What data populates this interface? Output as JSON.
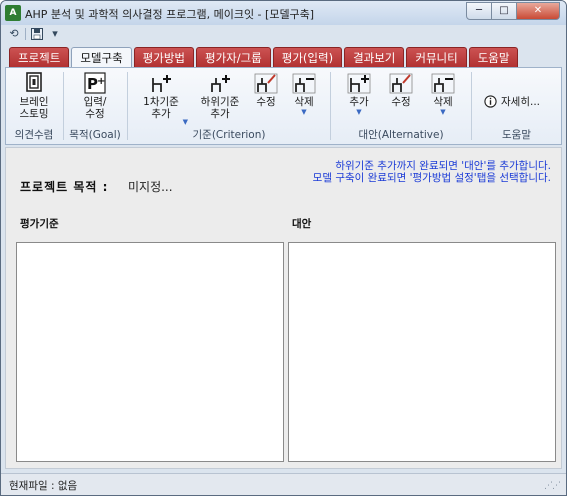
{
  "window": {
    "title": "AHP 분석 및 과학적 의사결정 프로그램, 메이크잇 - [모델구축]",
    "min_label": "─",
    "max_label": "□",
    "close_label": "✕"
  },
  "qat": {
    "undo_glyph": "⟲",
    "save_glyph": "▾"
  },
  "tabs": [
    "프로젝트",
    "모델구축",
    "평가방법",
    "평가자/그룹",
    "평가(입력)",
    "결과보기",
    "커뮤니티",
    "도움말"
  ],
  "active_tab": "모델구축",
  "ribbon": {
    "groups": {
      "brainstorm": {
        "label": "의견수렴",
        "button": "브레인\n스토밍"
      },
      "goal": {
        "label": "목적(Goal)",
        "button": "입력/\n수정"
      },
      "criterion": {
        "label": "기준(Criterion)",
        "add_first": "1차기준\n추가",
        "add_sub": "하위기준\n추가",
        "edit": "수정",
        "delete": "삭제"
      },
      "alternative": {
        "label": "대안(Alternative)",
        "add": "추가",
        "edit": "수정",
        "delete": "삭제"
      },
      "help": {
        "label": "도움말",
        "details": "자세히..."
      }
    }
  },
  "hint": {
    "line1": "하위기준 추가까지 완료되면 '대안'를 추가합니다.",
    "line2": "모델 구축이 완료되면 '평가방법 설정'탭을 선택합니다."
  },
  "goal": {
    "label": "프로젝트 목적 :",
    "value": "미지정..."
  },
  "panels": {
    "criteria": "평가기준",
    "alternatives": "대안"
  },
  "status": {
    "current_file": "현재파일 : 없음"
  },
  "colors": {
    "tab_red": "#b03030",
    "hint_blue": "#1a3ad6"
  }
}
